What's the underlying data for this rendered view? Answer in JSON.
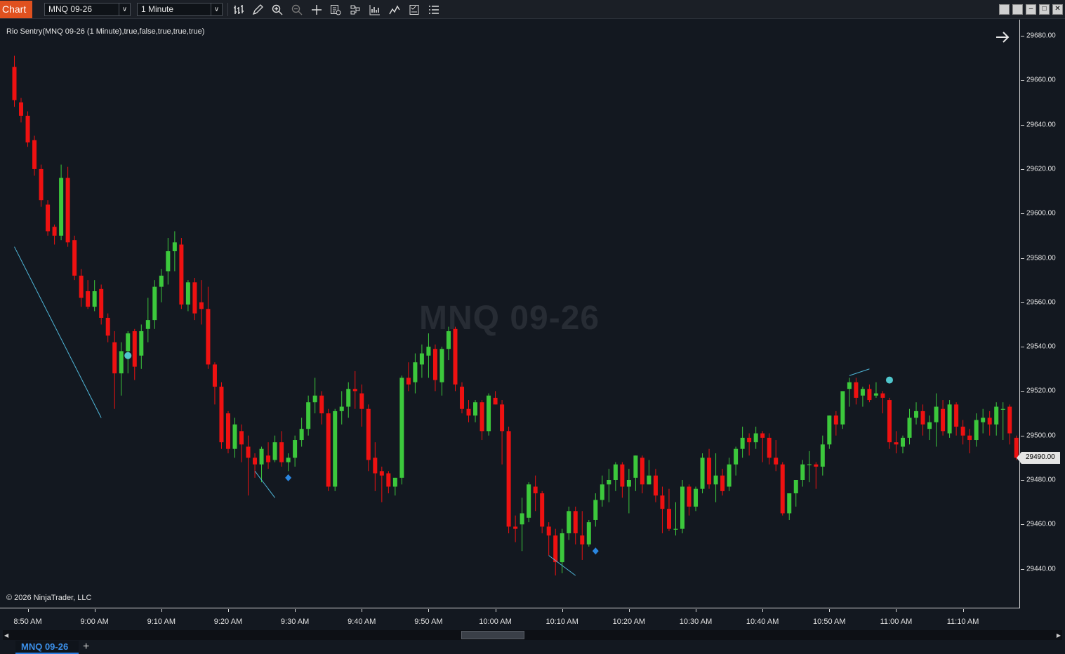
{
  "toolbar": {
    "chart_tab": "Chart",
    "instrument": "MNQ 09-26",
    "interval": "1 Minute",
    "icons": [
      "bar-type-icon",
      "draw-icon",
      "zoom-in-icon",
      "zoom-out-icon",
      "crosshair-icon",
      "data-box-icon",
      "strategies-icon",
      "properties-icon",
      "indicators-icon",
      "templates-icon",
      "menu-icon"
    ]
  },
  "chart": {
    "indicator_label": "Rio Sentry(MNQ 09-26 (1 Minute),true,false,true,true,true)",
    "watermark": "MNQ 09-26",
    "copyright": "© 2026 NinjaTrader, LLC",
    "current_price": "29490.00",
    "colors": {
      "up": "#3cc83c",
      "down": "#ee1111",
      "wick": "#cfcfcf",
      "line": "#4fb6d8",
      "dot": "#4fc6cc",
      "diamond": "#2a86e0",
      "background": "#131820"
    }
  },
  "price_axis": [
    "29680.00",
    "29660.00",
    "29640.00",
    "29620.00",
    "29600.00",
    "29580.00",
    "29560.00",
    "29540.00",
    "29520.00",
    "29500.00",
    "29480.00",
    "29460.00",
    "29440.00"
  ],
  "time_axis": [
    "8:50 AM",
    "9:00 AM",
    "9:10 AM",
    "9:20 AM",
    "9:30 AM",
    "9:40 AM",
    "9:50 AM",
    "10:00 AM",
    "10:10 AM",
    "10:20 AM",
    "10:30 AM",
    "10:40 AM",
    "10:50 AM",
    "11:00 AM",
    "11:10 AM"
  ],
  "tabs": {
    "active": "MNQ 09-26",
    "add": "+"
  },
  "chart_data": {
    "type": "candlestick",
    "price_range": [
      29427,
      29686
    ],
    "first_bar": "8:50 AM",
    "bar_interval_minutes": 1,
    "ohlc": [
      [
        29666,
        29671,
        29648,
        29651
      ],
      [
        29650,
        29652,
        29641,
        29644
      ],
      [
        29644,
        29646,
        29630,
        29632
      ],
      [
        29633,
        29635,
        29617,
        29620
      ],
      [
        29620,
        29622,
        29603,
        29606
      ],
      [
        29604,
        29606,
        29590,
        29592
      ],
      [
        29594,
        29595,
        29586,
        29590
      ],
      [
        29590,
        29622,
        29588,
        29616
      ],
      [
        29616,
        29621,
        29585,
        29587
      ],
      [
        29588,
        29590,
        29570,
        29572
      ],
      [
        29572,
        29575,
        29558,
        29562
      ],
      [
        29565,
        29570,
        29557,
        29558
      ],
      [
        29558,
        29570,
        29556,
        29565
      ],
      [
        29566,
        29568,
        29550,
        29553
      ],
      [
        29553,
        29555,
        29542,
        29545
      ],
      [
        29542,
        29547,
        29512,
        29528
      ],
      [
        29528,
        29542,
        29518,
        29538
      ],
      [
        29538,
        29547,
        29528,
        29546
      ],
      [
        29547,
        29548,
        29525,
        29531
      ],
      [
        29536,
        29550,
        29530,
        29547
      ],
      [
        29548,
        29562,
        29542,
        29552
      ],
      [
        29552,
        29570,
        29548,
        29567
      ],
      [
        29567,
        29575,
        29560,
        29572
      ],
      [
        29574,
        29589,
        29568,
        29583
      ],
      [
        29583,
        29592,
        29574,
        29587
      ],
      [
        29586,
        29589,
        29557,
        29559
      ],
      [
        29559,
        29570,
        29556,
        29569
      ],
      [
        29569,
        29571,
        29552,
        29555
      ],
      [
        29560,
        29570,
        29550,
        29557
      ],
      [
        29557,
        29567,
        29530,
        29532
      ],
      [
        29532,
        29533,
        29514,
        29522
      ],
      [
        29522,
        29524,
        29494,
        29497
      ],
      [
        29510,
        29511,
        29492,
        29494
      ],
      [
        29494,
        29508,
        29490,
        29505
      ],
      [
        29502,
        29505,
        29488,
        29496
      ],
      [
        29495,
        29500,
        29473,
        29490
      ],
      [
        29490,
        29492,
        29481,
        29487
      ],
      [
        29487,
        29495,
        29479,
        29494
      ],
      [
        29491,
        29497,
        29485,
        29488
      ],
      [
        29489,
        29500,
        29488,
        29497
      ],
      [
        29497,
        29502,
        29486,
        29488
      ],
      [
        29488,
        29492,
        29484,
        29490
      ],
      [
        29490,
        29500,
        29486,
        29498
      ],
      [
        29498,
        29508,
        29495,
        29503
      ],
      [
        29503,
        29518,
        29500,
        29515
      ],
      [
        29515,
        29526,
        29510,
        29518
      ],
      [
        29518,
        29520,
        29505,
        29510
      ],
      [
        29510,
        29512,
        29475,
        29477
      ],
      [
        29477,
        29512,
        29475,
        29511
      ],
      [
        29511,
        29520,
        29505,
        29513
      ],
      [
        29513,
        29524,
        29508,
        29521
      ],
      [
        29521,
        29529,
        29512,
        29520
      ],
      [
        29519,
        29523,
        29504,
        29512
      ],
      [
        29512,
        29514,
        29484,
        29489
      ],
      [
        29490,
        29497,
        29475,
        29483
      ],
      [
        29484,
        29486,
        29470,
        29482
      ],
      [
        29483,
        29484,
        29474,
        29477
      ],
      [
        29477,
        29481,
        29473,
        29481
      ],
      [
        29481,
        29527,
        29478,
        29526
      ],
      [
        29526,
        29533,
        29520,
        29523
      ],
      [
        29524,
        29537,
        29519,
        29533
      ],
      [
        29532,
        29541,
        29526,
        29537
      ],
      [
        29536,
        29546,
        29526,
        29540
      ],
      [
        29539,
        29541,
        29520,
        29525
      ],
      [
        29524,
        29540,
        29518,
        29539
      ],
      [
        29539,
        29549,
        29534,
        29547
      ],
      [
        29548,
        29549,
        29520,
        29523
      ],
      [
        29522,
        29524,
        29510,
        29512
      ],
      [
        29512,
        29516,
        29506,
        29509
      ],
      [
        29509,
        29516,
        29506,
        29515
      ],
      [
        29515,
        29516,
        29498,
        29502
      ],
      [
        29502,
        29519,
        29500,
        29518
      ],
      [
        29517,
        29520,
        29514,
        29514
      ],
      [
        29514,
        29516,
        29487,
        29502
      ],
      [
        29502,
        29504,
        29456,
        29459
      ],
      [
        29459,
        29464,
        29452,
        29458
      ],
      [
        29460,
        29472,
        29448,
        29465
      ],
      [
        29463,
        29479,
        29461,
        29478
      ],
      [
        29477,
        29482,
        29466,
        29474
      ],
      [
        29474,
        29475,
        29456,
        29459
      ],
      [
        29459,
        29461,
        29446,
        29455
      ],
      [
        29455,
        29458,
        29437,
        29443
      ],
      [
        29443,
        29458,
        29438,
        29456
      ],
      [
        29456,
        29468,
        29453,
        29466
      ],
      [
        29466,
        29468,
        29451,
        29456
      ],
      [
        29455,
        29466,
        29444,
        29451
      ],
      [
        29451,
        29462,
        29450,
        29461
      ],
      [
        29462,
        29474,
        29459,
        29471
      ],
      [
        29471,
        29482,
        29468,
        29478
      ],
      [
        29478,
        29485,
        29470,
        29480
      ],
      [
        29480,
        29488,
        29475,
        29487
      ],
      [
        29487,
        29488,
        29472,
        29477
      ],
      [
        29477,
        29485,
        29465,
        29480
      ],
      [
        29481,
        29491,
        29475,
        29491
      ],
      [
        29490,
        29491,
        29474,
        29478
      ],
      [
        29478,
        29489,
        29478,
        29482
      ],
      [
        29482,
        29485,
        29470,
        29473
      ],
      [
        29473,
        29477,
        29456,
        29467
      ],
      [
        29467,
        29476,
        29457,
        29458
      ],
      [
        29458,
        29470,
        29455,
        29458
      ],
      [
        29458,
        29480,
        29456,
        29477
      ],
      [
        29477,
        29478,
        29464,
        29468
      ],
      [
        29468,
        29477,
        29466,
        29476
      ],
      [
        29476,
        29492,
        29474,
        29490
      ],
      [
        29490,
        29494,
        29476,
        29478
      ],
      [
        29478,
        29492,
        29470,
        29482
      ],
      [
        29482,
        29485,
        29473,
        29475
      ],
      [
        29477,
        29490,
        29475,
        29487
      ],
      [
        29487,
        29495,
        29482,
        29494
      ],
      [
        29494,
        29504,
        29490,
        29499
      ],
      [
        29499,
        29501,
        29491,
        29497
      ],
      [
        29497,
        29504,
        29494,
        29501
      ],
      [
        29501,
        29502,
        29488,
        29499
      ],
      [
        29499,
        29501,
        29487,
        29490
      ],
      [
        29490,
        29498,
        29484,
        29487
      ],
      [
        29487,
        29488,
        29464,
        29465
      ],
      [
        29465,
        29474,
        29462,
        29474
      ],
      [
        29474,
        29480,
        29468,
        29480
      ],
      [
        29480,
        29489,
        29477,
        29487
      ],
      [
        29487,
        29493,
        29479,
        29487
      ],
      [
        29487,
        29488,
        29476,
        29486
      ],
      [
        29486,
        29500,
        29482,
        29496
      ],
      [
        29496,
        29509,
        29494,
        29509
      ],
      [
        29509,
        29511,
        29500,
        29505
      ],
      [
        29505,
        29519,
        29503,
        29520
      ],
      [
        29521,
        29526,
        29513,
        29524
      ],
      [
        29524,
        29526,
        29514,
        29517
      ],
      [
        29518,
        29522,
        29513,
        29521
      ],
      [
        29521,
        29523,
        29515,
        29516
      ],
      [
        29518,
        29524,
        29517,
        29519
      ],
      [
        29519,
        29520,
        29510,
        29517
      ],
      [
        29516,
        29517,
        29494,
        29497
      ],
      [
        29497,
        29502,
        29492,
        29496
      ],
      [
        29495,
        29500,
        29492,
        29499
      ],
      [
        29499,
        29512,
        29496,
        29508
      ],
      [
        29508,
        29515,
        29505,
        29511
      ],
      [
        29511,
        29514,
        29500,
        29505
      ],
      [
        29503,
        29509,
        29498,
        29506
      ],
      [
        29506,
        29519,
        29495,
        29513
      ],
      [
        29512,
        29516,
        29500,
        29502
      ],
      [
        29501,
        29516,
        29499,
        29514
      ],
      [
        29514,
        29515,
        29500,
        29504
      ],
      [
        29504,
        29507,
        29496,
        29500
      ],
      [
        29500,
        29503,
        29492,
        29498
      ],
      [
        29498,
        29510,
        29495,
        29507
      ],
      [
        29506,
        29512,
        29501,
        29508
      ],
      [
        29508,
        29511,
        29500,
        29505
      ],
      [
        29505,
        29515,
        29500,
        29513
      ],
      [
        29512,
        29515,
        29498,
        29512
      ],
      [
        29513,
        29514,
        29496,
        29501
      ],
      [
        29499,
        29500,
        29489,
        29490
      ],
      [
        29490,
        29497,
        29488,
        29497
      ],
      [
        29496,
        29505,
        29490,
        29490
      ]
    ],
    "lines": [
      {
        "from": [
          0,
          29585
        ],
        "to": [
          13,
          29508
        ]
      },
      {
        "from": [
          36,
          29484
        ],
        "to": [
          39,
          29472
        ]
      },
      {
        "from": [
          80,
          29446
        ],
        "to": [
          84,
          29437
        ]
      },
      {
        "from": [
          125,
          29527
        ],
        "to": [
          128,
          29530
        ]
      }
    ],
    "dots": [
      [
        17,
        29536
      ],
      [
        131,
        29525
      ]
    ],
    "diamonds": [
      [
        41,
        29481
      ],
      [
        87,
        29448
      ]
    ]
  }
}
